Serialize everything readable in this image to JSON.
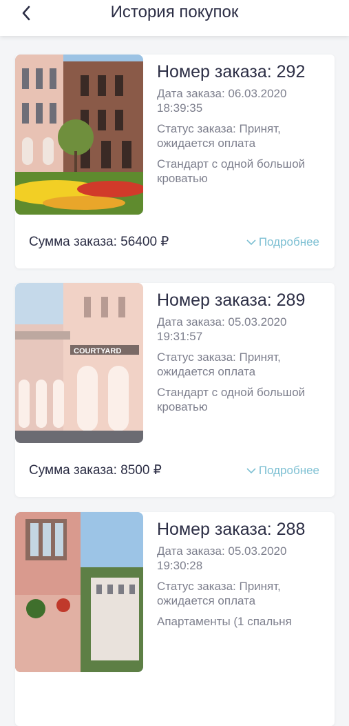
{
  "header": {
    "title": "История покупок"
  },
  "orders": [
    {
      "number": "Номер заказа: 292",
      "date": "Дата заказа: 06.03.2020 18:39:35",
      "status": "Статус заказа: Принят, ожидается оплата",
      "room": "Стандарт с одной большой кроватью",
      "sum": "Сумма заказа: 56400 ₽",
      "more": "Подробнее"
    },
    {
      "number": "Номер заказа: 289",
      "date": "Дата заказа: 05.03.2020 19:31:57",
      "status": "Статус заказа: Принят, ожидается оплата",
      "room": "Стандарт с одной большой кроватью",
      "sum": "Сумма заказа: 8500 ₽",
      "more": "Подробнее",
      "sign": "COURTYARD"
    },
    {
      "number": "Номер заказа: 288",
      "date": "Дата заказа: 05.03.2020 19:30:28",
      "status": "Статус заказа: Принят, ожидается оплата",
      "room": "Апартаменты (1 спальня"
    }
  ]
}
